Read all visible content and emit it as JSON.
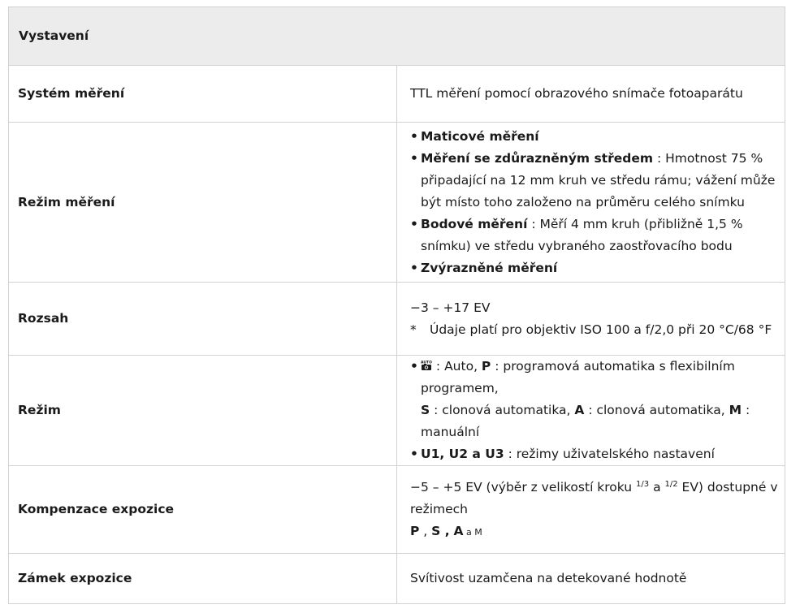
{
  "header": "Vystavení",
  "rows": {
    "system": {
      "label": "Systém měření",
      "value": "TTL měření pomocí obrazového snímače fotoaparátu"
    },
    "metering": {
      "label": "Režim měření",
      "items": [
        {
          "bold": "Maticové měření",
          "text": ""
        },
        {
          "bold": "Měření se zdůrazněným středem",
          "text": " : Hmotnost 75 % připadající na 12 mm kruh ve středu rámu; vážení může být místo toho založeno na průměru celého snímku"
        },
        {
          "bold": "Bodové měření",
          "text": " : Měří 4 mm kruh (přibližně 1,5 % snímku) ve středu vybraného zaostřovacího bodu"
        },
        {
          "bold": "Zvýrazněné měření",
          "text": ""
        }
      ]
    },
    "range": {
      "label": "Rozsah",
      "value": "−3 – +17 EV",
      "note_mark": "*",
      "note": "Údaje platí pro objektiv ISO 100 a f/2,0 při 20 °C/68 °F"
    },
    "mode": {
      "label": "Režim",
      "auto_icon": "auto-camera-icon",
      "auto_text": " : Auto, ",
      "p": "P",
      "p_text": " : programová automatika s flexibilním programem,",
      "s": "S",
      "s_text": " : clonová automatika, ",
      "a": "A",
      "a_text": " : clonová automatika, ",
      "m": "M",
      "m_text": " : manuální",
      "u_bold": "U1, U2 a U3",
      "u_text": " : režimy uživatelského nastavení"
    },
    "compensation": {
      "label": "Kompenzace expozice",
      "text1": "−5 – +5 EV (výběr z velikostí kroku ",
      "sup1": "1/3",
      "text2": " a ",
      "sup2": "1/2",
      "text3": " EV) dostupné v režimech",
      "p": "P",
      "sep1": " , ",
      "s": "S ,",
      "sep2": " ",
      "a": "A",
      "tail": " a M"
    },
    "lock": {
      "label": "Zámek expozice",
      "value": "Svítivost uzamčena na detekované hodnotě"
    }
  }
}
